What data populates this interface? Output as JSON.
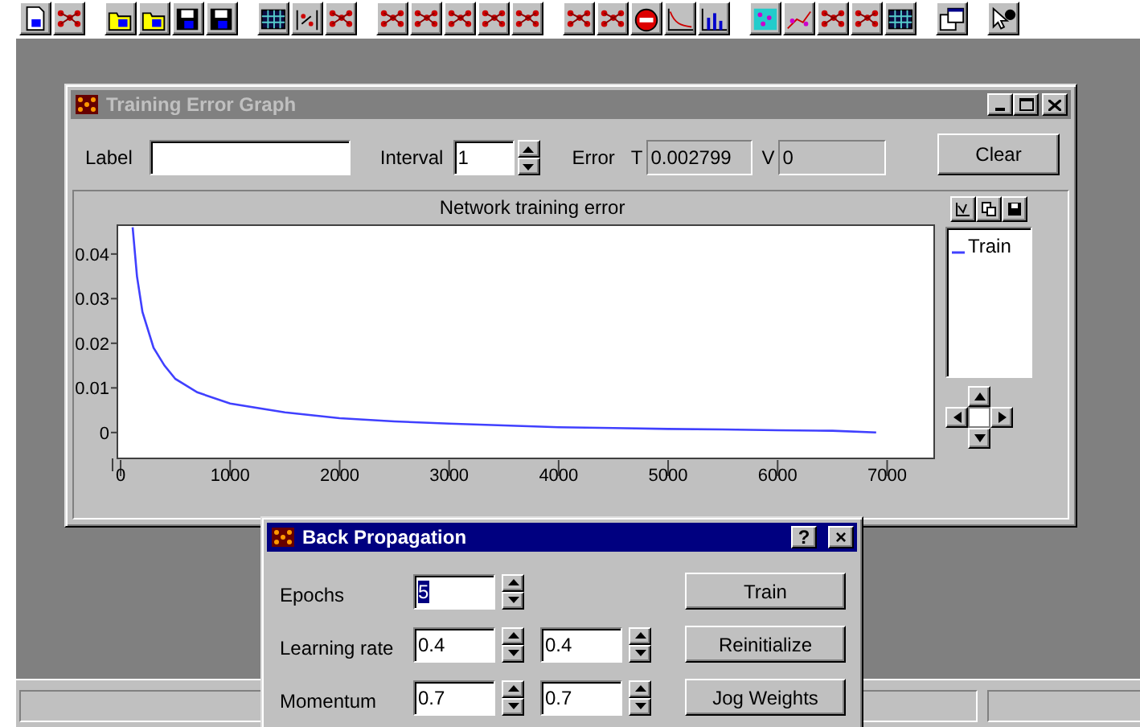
{
  "graph_window": {
    "title": "Training Error Graph",
    "active": false,
    "label_field": {
      "label": "Label"
    },
    "interval": {
      "label": "Interval",
      "value": "1"
    },
    "error": {
      "label": "Error",
      "train_label": "T",
      "train_value": "0.002799",
      "validation_label": "V",
      "validation_value": "0"
    },
    "clear_button": "Clear",
    "chart": {
      "chart_data": {
        "type": "line",
        "title": "Network training error",
        "xlim": [
          -15,
          7415
        ],
        "ylim": [
          -0.0058,
          0.0461
        ],
        "xticks": [
          0,
          1000,
          2000,
          3000,
          4000,
          5000,
          6000,
          7000
        ],
        "yticks": [
          {
            "value": 0,
            "label": "0"
          },
          {
            "value": 0.01,
            "label": "0.01"
          },
          {
            "value": 0.02,
            "label": "0.02"
          },
          {
            "value": 0.03,
            "label": "0.03"
          },
          {
            "value": 0.04,
            "label": "0.04"
          }
        ],
        "x": [
          110,
          150,
          200,
          300,
          400,
          500,
          700,
          1000,
          1500,
          2000,
          2500,
          3000,
          3500,
          4000,
          4500,
          5000,
          5500,
          6000,
          6500,
          6900
        ],
        "series": [
          {
            "name": "Train",
            "color": "#4040ff",
            "values": [
              0.046,
              0.035,
              0.027,
              0.019,
              0.015,
              0.012,
              0.009,
              0.0065,
              0.0045,
              0.0032,
              0.0025,
              0.002,
              0.0016,
              0.0012,
              0.001,
              0.0008,
              0.0007,
              0.0005,
              0.0004,
              0.0
            ]
          }
        ]
      }
    }
  },
  "dialog": {
    "title": "Back Propagation",
    "active": true,
    "help_button": "?",
    "close_button": "×",
    "rows": [
      {
        "label": "Epochs",
        "fields": [
          {
            "value": "5",
            "text_selected": true
          }
        ],
        "button": "Train"
      },
      {
        "label": "Learning rate",
        "fields": [
          {
            "value": "0.4",
            "text_selected": false
          },
          {
            "value": "0.4",
            "text_selected": false
          }
        ],
        "button": "Reinitialize"
      },
      {
        "label": "Momentum",
        "fields": [
          {
            "value": "0.7",
            "text_selected": false
          },
          {
            "value": "0.7",
            "text_selected": false
          }
        ],
        "button": "Jog Weights"
      }
    ]
  }
}
